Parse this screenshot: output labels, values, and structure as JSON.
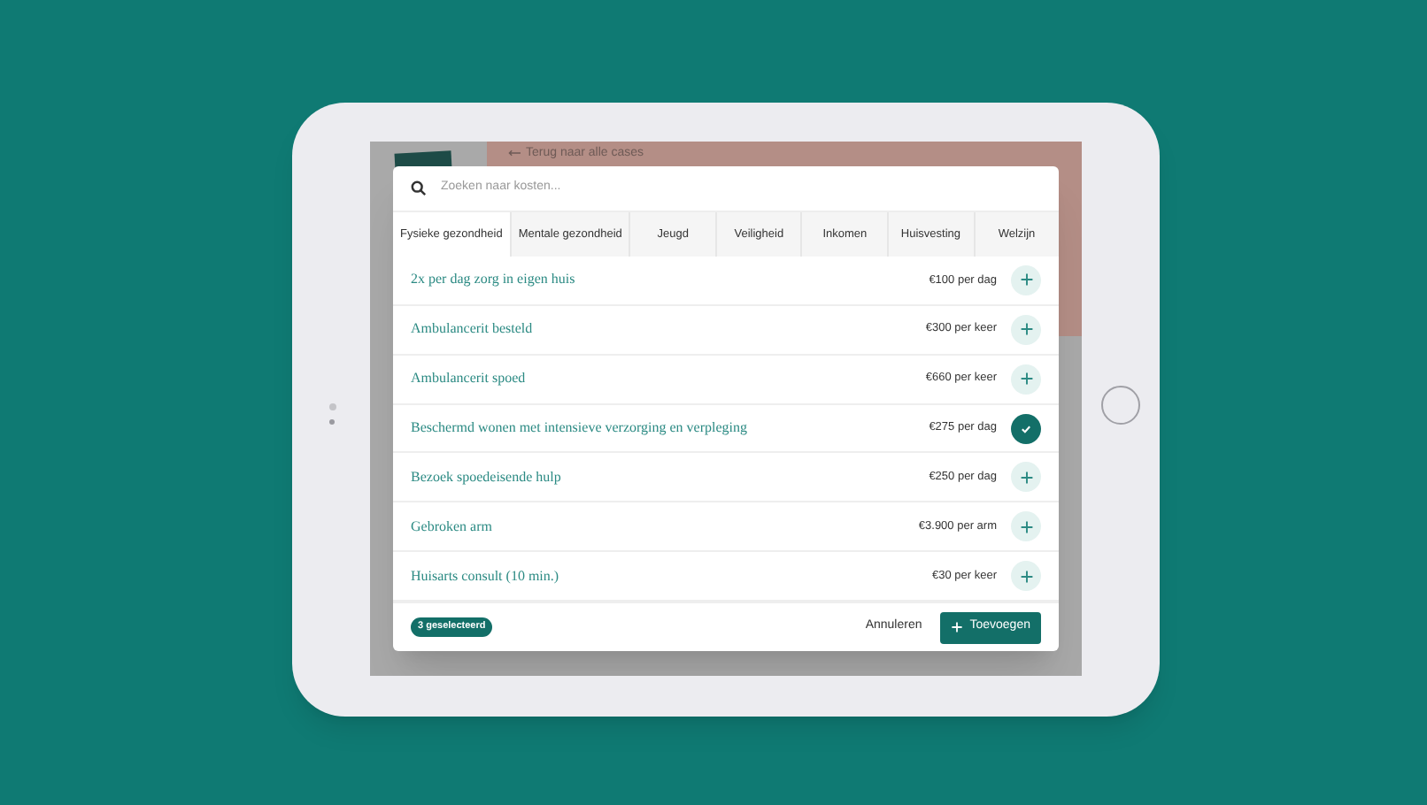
{
  "background_app": {
    "back_link": "Terug naar alle cases"
  },
  "modal": {
    "search": {
      "placeholder": "Zoeken naar kosten..."
    },
    "tabs": [
      {
        "label": "Fysieke gezondheid",
        "selected": true
      },
      {
        "label": "Mentale gezondheid",
        "selected": false
      },
      {
        "label": "Jeugd",
        "selected": false
      },
      {
        "label": "Veiligheid",
        "selected": false
      },
      {
        "label": "Inkomen",
        "selected": false
      },
      {
        "label": "Huisvesting",
        "selected": false
      },
      {
        "label": "Welzijn",
        "selected": false
      }
    ],
    "items": [
      {
        "name": "2x per dag zorg in eigen huis",
        "price": "€100 per dag",
        "selected": false
      },
      {
        "name": "Ambulancerit besteld",
        "price": "€300 per keer",
        "selected": false
      },
      {
        "name": "Ambulancerit spoed",
        "price": "€660 per keer",
        "selected": false
      },
      {
        "name": "Beschermd wonen met intensieve verzorging en verpleging",
        "price": "€275 per dag",
        "selected": true
      },
      {
        "name": "Bezoek spoedeisende hulp",
        "price": "€250 per dag",
        "selected": false
      },
      {
        "name": "Gebroken arm",
        "price": "€3.900 per arm",
        "selected": false
      },
      {
        "name": "Huisarts consult (10 min.)",
        "price": "€30 per keer",
        "selected": false
      }
    ],
    "footer": {
      "selected_count": "3 geselecteerd",
      "cancel": "Annuleren",
      "add": "Toevoegen"
    }
  }
}
